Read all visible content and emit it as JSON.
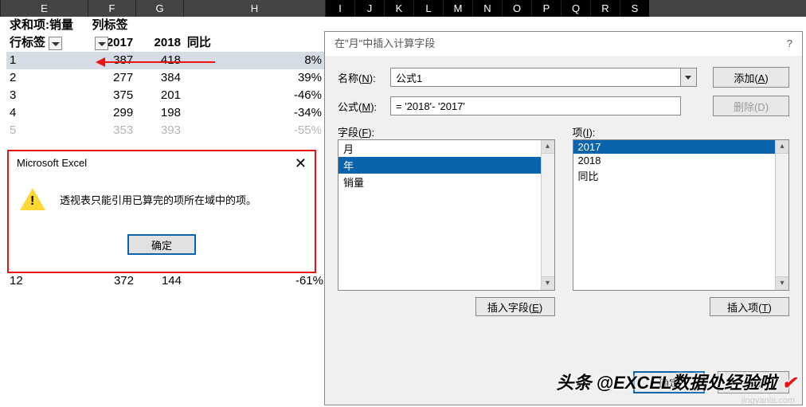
{
  "columns": [
    "E",
    "F",
    "G",
    "H",
    "I",
    "J",
    "K",
    "L",
    "M",
    "N",
    "O",
    "P",
    "Q",
    "R",
    "S"
  ],
  "pivot": {
    "measure_label": "求和项:销量",
    "col_labels_label": "列标签",
    "row_labels_label": "行标签",
    "col_headers": [
      "2017",
      "2018",
      "同比"
    ],
    "rows": [
      {
        "label": "1",
        "v2017": "387",
        "v2018": "418",
        "pct": "8%",
        "highlighted": true
      },
      {
        "label": "2",
        "v2017": "277",
        "v2018": "384",
        "pct": "39%"
      },
      {
        "label": "3",
        "v2017": "375",
        "v2018": "201",
        "pct": "-46%"
      },
      {
        "label": "4",
        "v2017": "299",
        "v2018": "198",
        "pct": "-34%"
      },
      {
        "label": "5",
        "v2017": "353",
        "v2018": "393",
        "pct": "-55%",
        "obscured": true
      },
      {
        "label": "12",
        "v2017": "372",
        "v2018": "144",
        "pct": "-61%",
        "below": true
      }
    ]
  },
  "msgbox": {
    "title": "Microsoft Excel",
    "text": "透视表只能引用已算完的项所在域中的项。",
    "ok": "确定",
    "close": "✕"
  },
  "dialog": {
    "title": "在\"月\"中插入计算字段",
    "help": "?",
    "name_label": "名称(",
    "name_key": "N",
    "name_label_tail": "):",
    "name_value": "公式1",
    "formula_label": "公式(",
    "formula_key": "M",
    "formula_label_tail": "):",
    "formula_value": "= '2018'- '2017'",
    "add_btn": "添加(",
    "add_key": "A",
    "add_tail": ")",
    "delete_btn": "删除(",
    "delete_key": "D",
    "delete_tail": ")",
    "fields_label": "字段(",
    "fields_key": "F",
    "fields_tail": "):",
    "fields": [
      "月",
      "年",
      "销量"
    ],
    "fields_selected": "年",
    "items_label": "项(",
    "items_key": "I",
    "items_tail": "):",
    "items": [
      "2017",
      "2018",
      "同比"
    ],
    "items_selected": "2017",
    "insert_field_btn": "插入字段(",
    "insert_field_key": "E",
    "insert_field_tail": ")",
    "insert_item_btn": "插入项(",
    "insert_item_key": "T",
    "insert_item_tail": ")",
    "ok": "确定",
    "close": "关闭"
  },
  "watermark": "头条 @EXCEL数据处经验啦",
  "watermark_sub": "jingyanla.com"
}
